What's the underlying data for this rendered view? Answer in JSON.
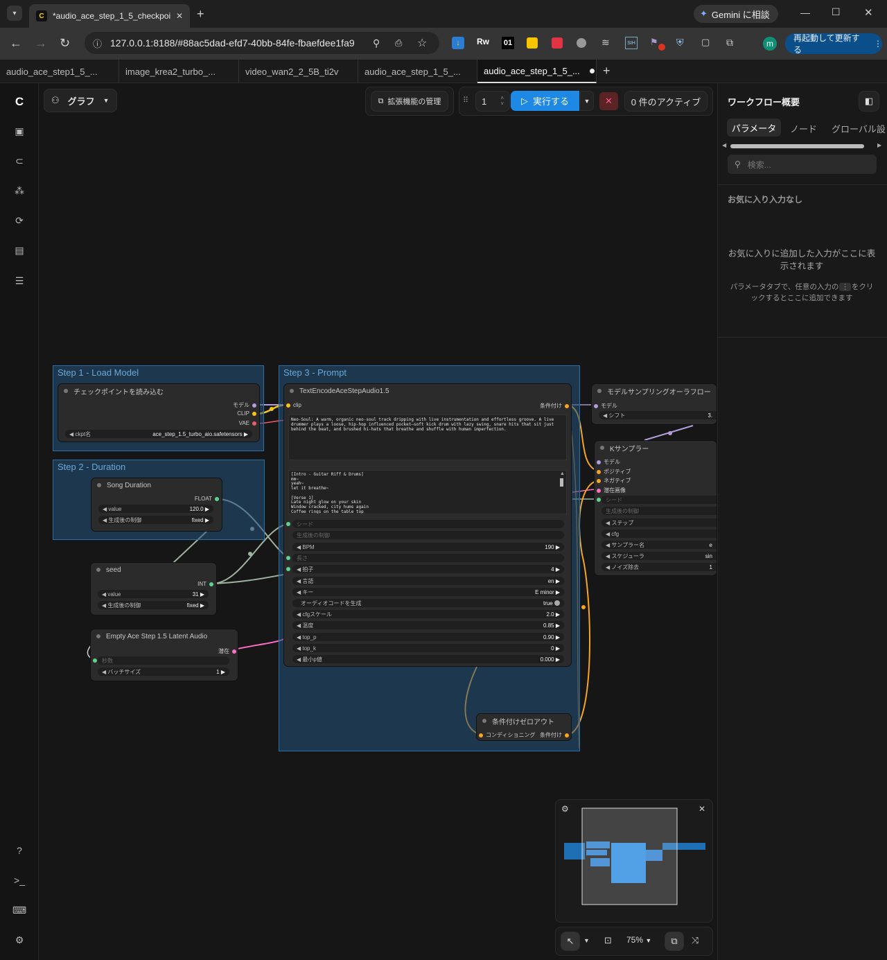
{
  "browser": {
    "tab_title": "*audio_ace_step_1_5_checkpoint",
    "url": "127.0.0.1:8188/#88ac5dad-efd7-40bb-84fe-fbaefdee1fa9",
    "gemini_label": "Gemini に相談",
    "update_button": "再起動して更新する",
    "profile_initial": "m",
    "ext_01": "01"
  },
  "workflow_tabs": [
    {
      "label": "audio_ace_step1_5_..."
    },
    {
      "label": "image_krea2_turbo_..."
    },
    {
      "label": "video_wan2_2_5B_ti2v"
    },
    {
      "label": "audio_ace_step_1_5_..."
    },
    {
      "label": "audio_ace_step_1_5_...",
      "active": true
    }
  ],
  "toolbar": {
    "graph_label": "グラフ",
    "extensions_label": "拡張機能の管理",
    "queue_count": "1",
    "run_label": "実行する",
    "active_label": "0 件のアクティブ"
  },
  "right_panel": {
    "title": "ワークフロー概要",
    "tabs": [
      "パラメータ",
      "ノード",
      "グローバル設"
    ],
    "search_placeholder": "検索...",
    "favorites_heading": "お気に入り入力なし",
    "empty_line1": "お気に入りに追加した入力がここに表",
    "empty_line2": "示されます",
    "hint_line1a": "パラメータタブで、任意の入力の",
    "hint_line1b": "をクリ",
    "hint_line2": "ックするとここに追加できます"
  },
  "groups": {
    "step1": "Step 1 - Load Model",
    "step2": "Step 2 - Duration",
    "step3": "Step 3 - Prompt"
  },
  "nodes": {
    "checkpoint": {
      "title": "チェックポイントを読み込む",
      "out_model": "モデル",
      "out_clip": "CLIP",
      "out_vae": "VAE",
      "w_label": "ckpt名",
      "w_value": "ace_step_1.5_turbo_aio.safetensors"
    },
    "duration": {
      "title": "Song Duration",
      "out": "FLOAT",
      "value_label": "value",
      "value": "120.0",
      "ctrl_label": "生成後の制御",
      "ctrl_value": "fixed"
    },
    "seed": {
      "title": "seed",
      "out": "INT",
      "value_label": "value",
      "value": "31",
      "ctrl_label": "生成後の制御",
      "ctrl_value": "fixed"
    },
    "latent": {
      "title": "Empty Ace Step 1.5 Latent Audio",
      "out": "潜在",
      "sec_label": "秒数",
      "batch_label": "バッチサイズ",
      "batch_value": "1"
    },
    "encode": {
      "title": "TextEncodeAceStepAudio1.5",
      "in_clip": "clip",
      "out": "条件付け",
      "tags_text": "Neo-Soul: A warm, organic neo-soul track dripping with live instrumentation and effortless groove. A live drummer plays a loose, hip-hop influenced pocket—soft kick drum with lazy swing, snare hits that sit just behind the beat, and brushed hi-hats that breathe and shuffle with human imperfection.",
      "lyrics_lines": [
        "[Intro - Guitar Riff & Drums]",
        "mm~",
        "yeah~",
        "let it breathe~",
        "",
        "[Verse 1]",
        "Late night glow on your skin",
        "Window cracked, city hums again",
        "Coffee rings on the table top"
      ],
      "w_seed": "シード",
      "w_ctrl": "生成後の制御",
      "w_bpm_label": "BPM",
      "w_bpm": "190",
      "w_len": "長さ",
      "w_beat_label": "拍子",
      "w_beat": "4",
      "w_lang_label": "言語",
      "w_lang": "en",
      "w_key_label": "キー",
      "w_key": "E minor",
      "w_audio_label": "オーディオコードを生成",
      "w_audio": "true",
      "w_cfg_label": "cfgスケール",
      "w_cfg": "2.0",
      "w_temp_label": "温度",
      "w_temp": "0.85",
      "w_topp_label": "top_p",
      "w_topp": "0.90",
      "w_topk_label": "top_k",
      "w_topk": "0",
      "w_minp_label": "最小p値",
      "w_minp": "0.000"
    },
    "zero": {
      "title": "条件付けゼロアウト",
      "in": "コンディショニング",
      "out": "条件付け"
    },
    "aura": {
      "title": "モデルサンプリングオーラフロー",
      "in": "モデル",
      "w_label": "シフト",
      "w_value": "3."
    },
    "ksampler": {
      "title": "Kサンプラー",
      "in_model": "モデル",
      "in_pos": "ポジティブ",
      "in_neg": "ネガティブ",
      "in_latent": "潜在画像",
      "w_seed": "シード",
      "w_ctrl": "生成後の制御",
      "w_steps": "ステップ",
      "w_cfg": "cfg",
      "w_sampler": "サンプラー名",
      "w_sampler_v": "e",
      "w_sched": "スケジューラ",
      "w_sched_v": "sin",
      "w_denoise": "ノイズ除去",
      "w_denoise_v": "1"
    }
  },
  "bottom_bar": {
    "zoom": "75%"
  },
  "colors": {
    "accent": "#1e88e5",
    "clip_wire": "#f5c518",
    "model_wire": "#b39ddb",
    "vae_wire": "#ef5a6f",
    "cond_wire": "#f5a623",
    "latent_wire": "#ff6ec7",
    "num_wire": "#9fb3a0",
    "group": "#2b6fa6"
  }
}
